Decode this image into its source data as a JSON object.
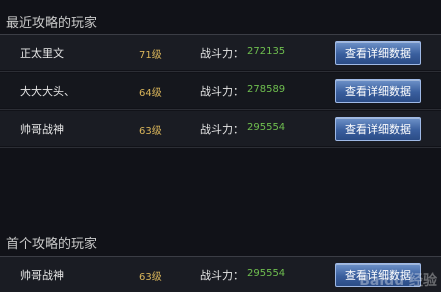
{
  "recent": {
    "title": "最近攻略的玩家",
    "players": [
      {
        "name": "正太里文",
        "level": "71级",
        "power_label": "战斗力：",
        "power": "272135",
        "button": "查看详细数据"
      },
      {
        "name": "大大大头、",
        "level": "64级",
        "power_label": "战斗力：",
        "power": "278589",
        "button": "查看详细数据"
      },
      {
        "name": "帅哥战神",
        "level": "63级",
        "power_label": "战斗力：",
        "power": "295554",
        "button": "查看详细数据"
      }
    ]
  },
  "first": {
    "title": "首个攻略的玩家",
    "players": [
      {
        "name": "帅哥战神",
        "level": "63级",
        "power_label": "战斗力：",
        "power": "295554",
        "button": "查看详细数据"
      }
    ]
  },
  "watermark": "Baidu 经验"
}
